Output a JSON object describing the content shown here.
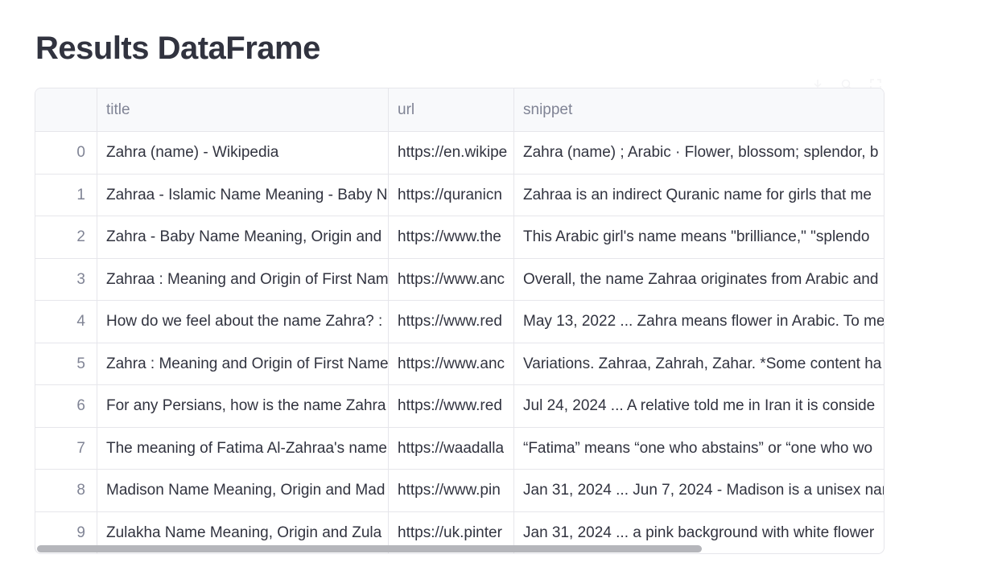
{
  "page": {
    "title": "Results DataFrame"
  },
  "toolbar": {
    "icons": [
      "download-icon",
      "search-icon",
      "fullscreen-icon"
    ]
  },
  "table": {
    "columns": {
      "index": "",
      "title": "title",
      "url": "url",
      "snippet": "snippet"
    },
    "rows": [
      {
        "index": "0",
        "title": "Zahra (name) - Wikipedia",
        "url": "https://en.wikipe",
        "snippet": "Zahra (name) ; Arabic · Flower, blossom; splendor, b"
      },
      {
        "index": "1",
        "title": "Zahraa - Islamic Name Meaning - Baby N",
        "url": "https://quranicn",
        "snippet": "Zahraa is an indirect Quranic name for girls that me"
      },
      {
        "index": "2",
        "title": "Zahra - Baby Name Meaning, Origin and",
        "url": "https://www.the",
        "snippet": "This Arabic girl's name means \"brilliance,\" \"splendo"
      },
      {
        "index": "3",
        "title": "Zahraa : Meaning and Origin of First Nam",
        "url": "https://www.anc",
        "snippet": "Overall, the name Zahraa originates from Arabic and"
      },
      {
        "index": "4",
        "title": "How do we feel about the name Zahra? :",
        "url": "https://www.red",
        "snippet": "May 13, 2022 ... Zahra means flower in Arabic. To me"
      },
      {
        "index": "5",
        "title": "Zahra : Meaning and Origin of First Name",
        "url": "https://www.anc",
        "snippet": "Variations. Zahraa, Zahrah, Zahar. *Some content ha"
      },
      {
        "index": "6",
        "title": "For any Persians, how is the name Zahra",
        "url": "https://www.red",
        "snippet": "Jul 24, 2024 ... A relative told me in Iran it is conside"
      },
      {
        "index": "7",
        "title": "The meaning of Fatima Al-Zahraa's name",
        "url": "https://waadalla",
        "snippet": "“Fatima” means “one who abstains” or “one who wo"
      },
      {
        "index": "8",
        "title": "Madison Name Meaning, Origin and Mad",
        "url": "https://www.pin",
        "snippet": "Jan 31, 2024 ... Jun 7, 2024 - Madison is a unisex nar"
      },
      {
        "index": "9",
        "title": "Zulakha Name Meaning, Origin and Zula",
        "url": "https://uk.pinter",
        "snippet": "Jan 31, 2024 ... a pink background with white flower"
      }
    ]
  },
  "scroll": {
    "horizontal_position": 0.0
  }
}
